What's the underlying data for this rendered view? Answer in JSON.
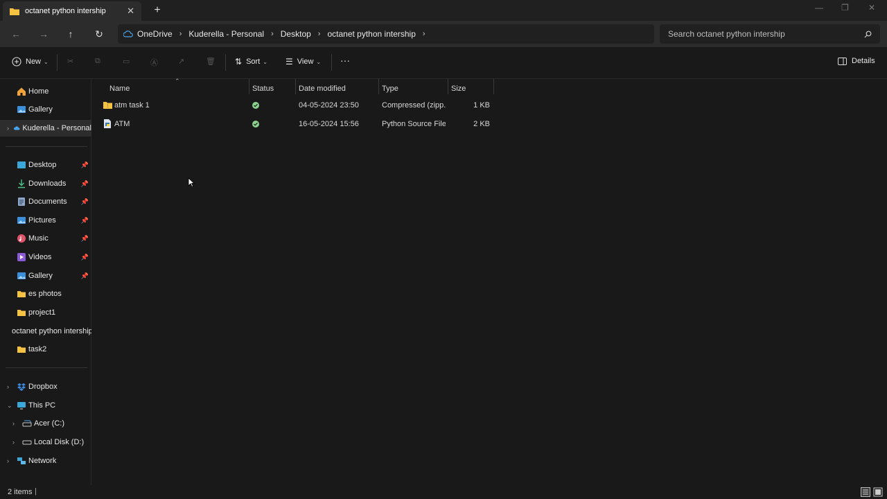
{
  "window": {
    "tab_title": "octanet python intership",
    "new_tab": "+",
    "close_tab": "✕"
  },
  "navigation": {
    "breadcrumbs": [
      "OneDrive",
      "Kuderella - Personal",
      "Desktop",
      "octanet python intership"
    ],
    "search_placeholder": "Search octanet python intership"
  },
  "toolbar": {
    "new_label": "New",
    "sort_label": "Sort",
    "view_label": "View",
    "more_label": "···",
    "details_label": "Details"
  },
  "sidebar": {
    "top": [
      {
        "label": "Home",
        "icon": "home-icon"
      },
      {
        "label": "Gallery",
        "icon": "gallery-icon"
      },
      {
        "label": "Kuderella - Personal",
        "icon": "onedrive-cloud-icon"
      }
    ],
    "quick_access": [
      {
        "label": "Desktop",
        "icon": "desktop-icon",
        "pinned": true
      },
      {
        "label": "Downloads",
        "icon": "downloads-icon",
        "pinned": true
      },
      {
        "label": "Documents",
        "icon": "documents-icon",
        "pinned": true
      },
      {
        "label": "Pictures",
        "icon": "pictures-icon",
        "pinned": true
      },
      {
        "label": "Music",
        "icon": "music-icon",
        "pinned": true
      },
      {
        "label": "Videos",
        "icon": "videos-icon",
        "pinned": true
      },
      {
        "label": "Gallery",
        "icon": "gallery-icon",
        "pinned": true
      },
      {
        "label": "es photos",
        "icon": "folder-icon",
        "pinned": false
      },
      {
        "label": "project1",
        "icon": "folder-icon",
        "pinned": false
      },
      {
        "label": "octanet python intership",
        "icon": "folder-icon",
        "pinned": false
      },
      {
        "label": "task2",
        "icon": "folder-icon",
        "pinned": false
      }
    ],
    "bottom": [
      {
        "label": "Dropbox",
        "icon": "dropbox-icon"
      },
      {
        "label": "This PC",
        "icon": "pc-icon"
      },
      {
        "label": "Acer (C:)",
        "icon": "drive-icon"
      },
      {
        "label": "Local Disk (D:)",
        "icon": "drive-icon"
      },
      {
        "label": "Network",
        "icon": "network-icon"
      }
    ]
  },
  "columns": {
    "name": "Name",
    "status": "Status",
    "date": "Date modified",
    "type": "Type",
    "size": "Size"
  },
  "files": [
    {
      "name": "atm task 1",
      "icon": "zip-folder-icon",
      "status": "synced",
      "date": "04-05-2024 23:50",
      "type": "Compressed (zipp...",
      "size": "1 KB"
    },
    {
      "name": "ATM",
      "icon": "python-file-icon",
      "status": "synced",
      "date": "16-05-2024 15:56",
      "type": "Python Source File",
      "size": "2 KB"
    }
  ],
  "status_bar": {
    "item_count": "2 items"
  },
  "colors": {
    "folder": "#f5c242",
    "synced": "#8bd08b",
    "onedrive": "#4aa3e8"
  }
}
